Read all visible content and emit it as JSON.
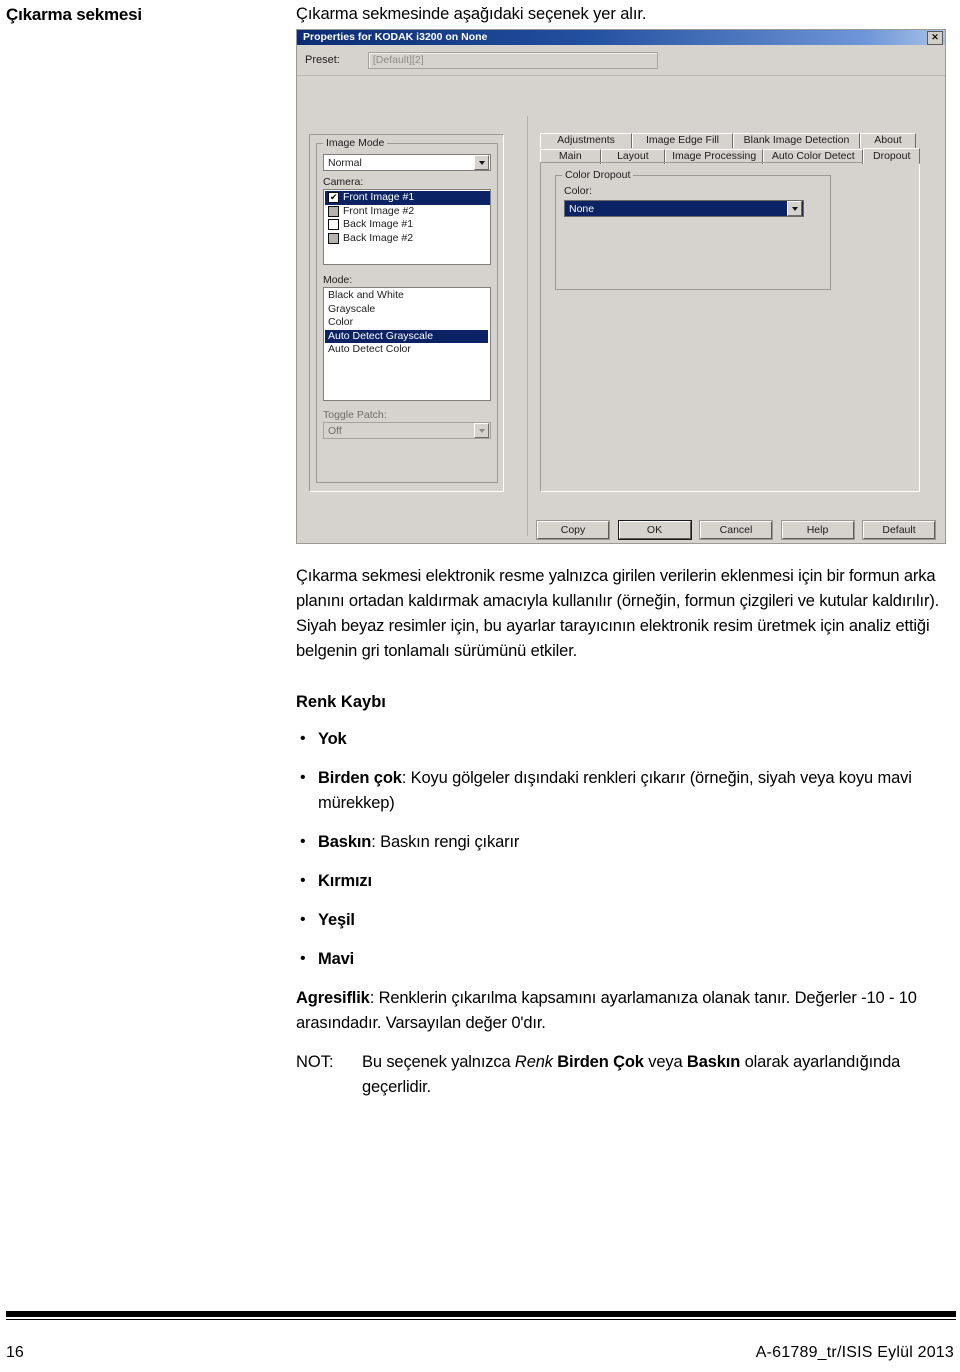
{
  "margin_heading": "Çıkarma sekmesi",
  "intro_line": "Çıkarma sekmesinde aşağıdaki seçenek yer alır.",
  "dialog": {
    "title": "Properties for KODAK i3200 on None",
    "close_icon_label": "✕",
    "preset": {
      "label": "Preset:",
      "value": "[Default][2]"
    },
    "image_mode": {
      "group_label": "Image Mode",
      "combo_value": "Normal",
      "camera_label": "Camera:",
      "camera_items": [
        {
          "label": "Front Image #1",
          "checked": true,
          "enabled": true,
          "selected": true
        },
        {
          "label": "Front Image #2",
          "checked": false,
          "enabled": false,
          "selected": false
        },
        {
          "label": "Back Image #1",
          "checked": false,
          "enabled": true,
          "selected": false
        },
        {
          "label": "Back Image #2",
          "checked": false,
          "enabled": false,
          "selected": false
        }
      ],
      "mode_label": "Mode:",
      "mode_items": [
        {
          "label": "Black and White",
          "selected": false
        },
        {
          "label": "Grayscale",
          "selected": false
        },
        {
          "label": "Color",
          "selected": false
        },
        {
          "label": "Auto Detect Grayscale",
          "selected": true
        },
        {
          "label": "Auto Detect Color",
          "selected": false
        }
      ],
      "toggle_patch_label": "Toggle Patch:",
      "toggle_patch_value": "Off"
    },
    "tabs_row1": [
      "Adjustments",
      "Image Edge Fill",
      "Blank Image Detection",
      "About"
    ],
    "tabs_row2": [
      "Main",
      "Layout",
      "Image Processing",
      "Auto Color Detect",
      "Dropout"
    ],
    "active_tab": "Dropout",
    "color_dropout": {
      "group_label": "Color Dropout",
      "color_label": "Color:",
      "color_value": "None"
    },
    "buttons": [
      "Copy",
      "OK",
      "Cancel",
      "Help",
      "Default"
    ],
    "default_button": "OK",
    "colors": {
      "titlebar_start": "#0b2c74",
      "titlebar_end": "#a9c3e8",
      "selection": "#0b2264",
      "face": "#d6d3ce"
    }
  },
  "body": {
    "paragraph1": "Çıkarma sekmesi elektronik resme yalnızca girilen verilerin eklenmesi için bir formun arka planını ortadan kaldırmak amacıyla kullanılır (örneğin, formun çizgileri ve kutular kaldırılır). Siyah beyaz resimler için, bu ayarlar tarayıcının elektronik resim üretmek için analiz ettiği belgenin gri tonlamalı sürümünü etkiler.",
    "section_heading": "Renk Kaybı",
    "bullets": [
      {
        "term": "Yok",
        "rest": ""
      },
      {
        "term": "Birden çok",
        "rest": ": Koyu gölgeler dışındaki renkleri çıkarır (örneğin, siyah veya koyu mavi mürekkep)"
      },
      {
        "term": "Baskın",
        "rest": ": Baskın rengi çıkarır"
      },
      {
        "term": "Kırmızı",
        "rest": ""
      },
      {
        "term": "Yeşil",
        "rest": ""
      },
      {
        "term": "Mavi",
        "rest": ""
      }
    ],
    "aggressiveness_term": "Agresiflik",
    "aggressiveness_rest": ": Renklerin çıkarılma kapsamını ayarlamanıza olanak tanır. Değerler -10 - 10 arasındadır. Varsayılan değer 0'dır.",
    "note_tag": "NOT:",
    "note_parts": {
      "p1": "Bu seçenek yalnızca ",
      "italic": "Renk",
      "p2": " ",
      "bold1": "Birden Çok",
      "p3": " veya ",
      "bold2": "Baskın",
      "p4": " olarak ayarlandığında geçerlidir."
    }
  },
  "footer": {
    "page_number": "16",
    "doc_ref": "A-61789_tr/ISIS  Eylül 2013"
  }
}
